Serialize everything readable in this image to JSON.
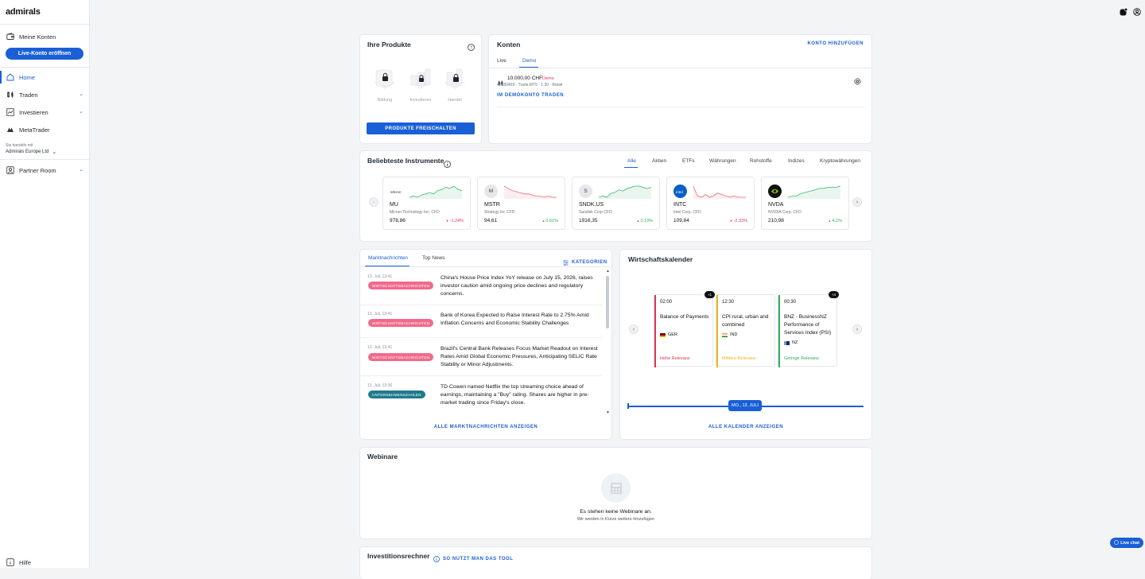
{
  "brand": {
    "logo_text": "admirals"
  },
  "sidebar": {
    "meine_konten": "Meine Konten",
    "live_button": "Live-Konto eröffnen",
    "items": [
      {
        "label": "Home",
        "icon": "home-icon",
        "active": true
      },
      {
        "label": "Traden",
        "icon": "candles-icon",
        "has_chevron": true
      },
      {
        "label": "Investieren",
        "icon": "chart-line-icon",
        "has_chevron": true
      },
      {
        "label": "MetaTrader",
        "icon": "metatrader-icon"
      }
    ],
    "entity_label": "Sie handeln mit",
    "entity_value": "Admirals Europe Ltd",
    "partner_room": "Partner Room",
    "help": "Hilfe"
  },
  "produkte": {
    "title": "Ihre Produkte",
    "items": [
      "Bildung",
      "Investieren",
      "Handel"
    ],
    "button": "PRODUKTE FREISCHALTEN"
  },
  "konten": {
    "title": "Konten",
    "add_link": "KONTO HINZUFÜGEN",
    "tabs": [
      "Live",
      "Demo"
    ],
    "active_tab": "Demo",
    "account": {
      "balance": "10.000,00 CHF",
      "tag": "Demo",
      "details": "42880469 · Trade.MT5 · 1:30 · Retail",
      "trade_link": "IM DEMOKONTO TRADEN"
    }
  },
  "instrumente": {
    "title": "Beliebteste Instrumente",
    "tabs": [
      "Alle",
      "Aktien",
      "ETFs",
      "Währungen",
      "Rohstoffe",
      "Indizes",
      "Kryptowährungen"
    ],
    "active_tab": "Alle",
    "cards": [
      {
        "symbol": "MU",
        "name": "Micron Technology Inc. CFD",
        "price": "978,86",
        "change": "-1.24%",
        "direction": "down",
        "logo": "micron",
        "chart_color": "#3fb96f",
        "spark": [
          6,
          7,
          6,
          8,
          9,
          10,
          9,
          12,
          13,
          15,
          14,
          16,
          13,
          12
        ]
      },
      {
        "symbol": "MSTR",
        "name": "Strategy Inc CFD",
        "price": "94,61",
        "change": "0.61%",
        "direction": "up",
        "logo": "M",
        "chart_color": "#e8707a",
        "spark": [
          16,
          14,
          12,
          11,
          10,
          9,
          9,
          8,
          7,
          7,
          6,
          7,
          6,
          6
        ]
      },
      {
        "symbol": "SNDK.US",
        "name": "Sandisk Corp CFD",
        "price": "1916,35",
        "change": "3.13%",
        "direction": "up",
        "logo": "S",
        "chart_color": "#3fb96f",
        "spark": [
          5,
          6,
          5,
          8,
          9,
          11,
          10,
          12,
          13,
          14,
          14,
          13,
          12,
          13
        ]
      },
      {
        "symbol": "INTC",
        "name": "Intel Corp. CFD",
        "price": "109,84",
        "change": "-2.33%",
        "direction": "down",
        "logo": "intel",
        "chart_color": "#e8707a",
        "spark": [
          16,
          9,
          8,
          10,
          8,
          9,
          11,
          10,
          9,
          8,
          9,
          8,
          8,
          8
        ]
      },
      {
        "symbol": "NVDA",
        "name": "NVIDIA Corp. CFD",
        "price": "210,98",
        "change": "4.1%",
        "direction": "up",
        "logo": "nvidia",
        "chart_color": "#3fb96f",
        "spark": [
          5,
          6,
          6,
          8,
          9,
          10,
          11,
          12,
          13,
          13,
          14,
          14,
          14,
          15
        ]
      }
    ]
  },
  "news": {
    "tabs": [
      "Marktnachrichten",
      "Top News"
    ],
    "active_tab": "Marktnachrichten",
    "categories": "KATEGORIEN",
    "items": [
      {
        "time": "13. Juli, 13:41",
        "badge": "WIRTSCHAFTSNACHRICHTEN",
        "badge_color": "#f06a8c",
        "text": "China's House Price Index YoY release on July 15, 2026, raises investor caution amid ongoing price declines and regulatory concerns."
      },
      {
        "time": "13. Juli, 13:41",
        "badge": "WIRTSCHAFTSNACHRICHTEN",
        "badge_color": "#f06a8c",
        "text": "Bank of Korea Expected to Raise Interest Rate to 2.75% Amid Inflation Concerns and Economic Stability Challenges"
      },
      {
        "time": "13. Juli, 13:41",
        "badge": "WIRTSCHAFTSNACHRICHTEN",
        "badge_color": "#f06a8c",
        "text": "Brazil's Central Bank Releases Focus Market Readout on Interest Rates Amid Global Economic Pressures, Anticipating SELIC Rate Stability or Minor Adjustments."
      },
      {
        "time": "13. Juli, 13:36",
        "badge": "UNTERNEHMENSZAHLEN",
        "badge_color": "#1f7a8c",
        "text": "TD Cowen named Netflix the top streaming choice ahead of earnings, maintaining a \"Buy\" rating. Shares are higher in pre-market trading since Friday's close."
      }
    ],
    "all_link": "ALLE MARKTNACHRICHTEN ANZEIGEN"
  },
  "kalender": {
    "title": "Wirtschaftskalender",
    "events": [
      {
        "time": "02:00",
        "title": "Balance of Payments",
        "country": "GER",
        "relevance": "Hohe Relevanz",
        "color": "#e0364f",
        "badge": "+1"
      },
      {
        "time": "12:30",
        "title": "CPI rural, urban and combined",
        "country": "IND",
        "relevance": "Mittlere Relevanz",
        "color": "#f2b31b",
        "badge": ""
      },
      {
        "time": "00:30",
        "title": "BNZ - BusinessNZ Performance of Services Index (PSI)",
        "country": "NZ",
        "relevance": "Geringe Relevanz",
        "color": "#2eae5a",
        "badge": "+4"
      }
    ],
    "date_label": "MO., 13. JULI",
    "all_link": "ALLE KALENDER ANZEIGEN"
  },
  "webinare": {
    "title": "Webinare",
    "empty_title": "Es stehen keine Webinare an.",
    "empty_sub": "Wir werden in Kürze weitere hinzufügen"
  },
  "rechner": {
    "title": "Investitionsrechner",
    "link": "SO NUTZT MAN DAS TOOL"
  },
  "live_chat": "Live chat"
}
